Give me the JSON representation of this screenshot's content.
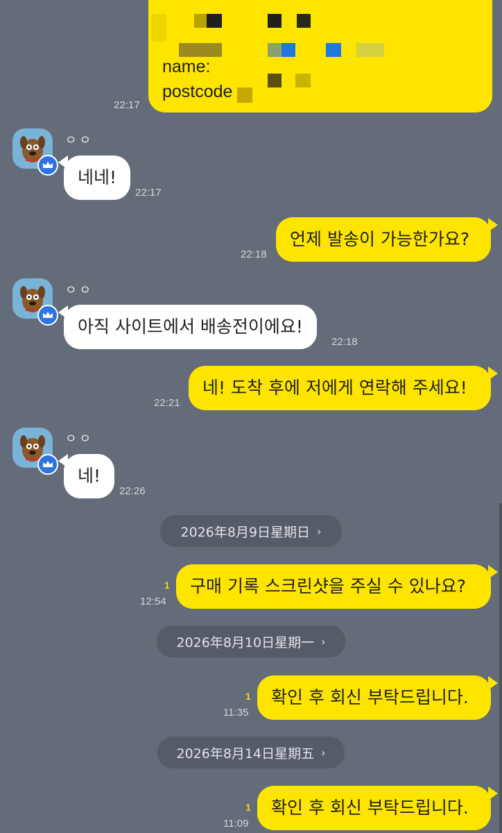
{
  "address_card": {
    "label_name": "name:",
    "label_postcode": "postcode",
    "time": "22:17"
  },
  "contact": {
    "name": "ㅇㅇ",
    "avatar_icon": "dog-character-avatar-icon",
    "badge_icon": "crown-badge-icon"
  },
  "messages": [
    {
      "text": "네네!",
      "time": "22:17"
    },
    {
      "text": "언제 발송이 가능한가요?",
      "time": "22:18"
    },
    {
      "text": "아직 사이트에서 배송전이에요!",
      "time": "22:18"
    },
    {
      "text": "네! 도착 후에 저에게 연락해 주세요!",
      "time": "22:21"
    },
    {
      "text": "네!",
      "time": "22:26"
    },
    {
      "text": "구매 기록 스크린샷을 주실 수 있나요?",
      "time": "12:54",
      "unread": "1"
    },
    {
      "text": "확인 후 회신 부탁드립니다.",
      "time": "11:35",
      "unread": "1"
    },
    {
      "text": "확인 후 회신 부탁드립니다.",
      "time": "11:09",
      "unread": "1"
    }
  ],
  "dates": [
    {
      "label": "2026年8月9日星期日"
    },
    {
      "label": "2026年8月10日星期一"
    },
    {
      "label": "2026年8月14日星期五"
    }
  ],
  "colors": {
    "background": "#646b79",
    "my_bubble": "#fde500",
    "their_bubble": "#ffffff",
    "unread": "#f5d90a"
  }
}
